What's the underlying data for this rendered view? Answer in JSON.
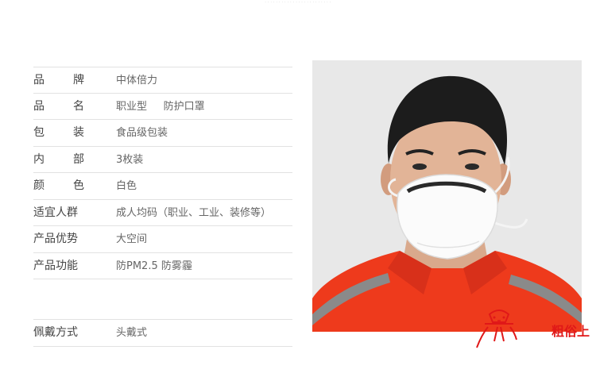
{
  "specs": [
    {
      "label": "品牌",
      "value": "中体倍力"
    },
    {
      "label": "品名",
      "value": "职业型     防护口罩"
    },
    {
      "label": "包装",
      "value": "食品级包装"
    },
    {
      "label": "内部",
      "value": "3枚装"
    },
    {
      "label": "颜色",
      "value": "白色"
    },
    {
      "label": "适宜人群",
      "value": "成人均码（职业、工业、装修等）"
    },
    {
      "label": "产品优势",
      "value": "大空间"
    },
    {
      "label": "产品功能",
      "value": "防PM2.5 防雾霾"
    },
    {
      "label": "佩戴方式",
      "value": "头戴式"
    }
  ],
  "logo": {
    "text": "粗俗上"
  },
  "colors": {
    "jacket": "#ee3a1c",
    "stripe": "#8a8a8a",
    "mask": "#fbfbfb",
    "logo": "#e01818",
    "divider": "#e2e2e2"
  }
}
